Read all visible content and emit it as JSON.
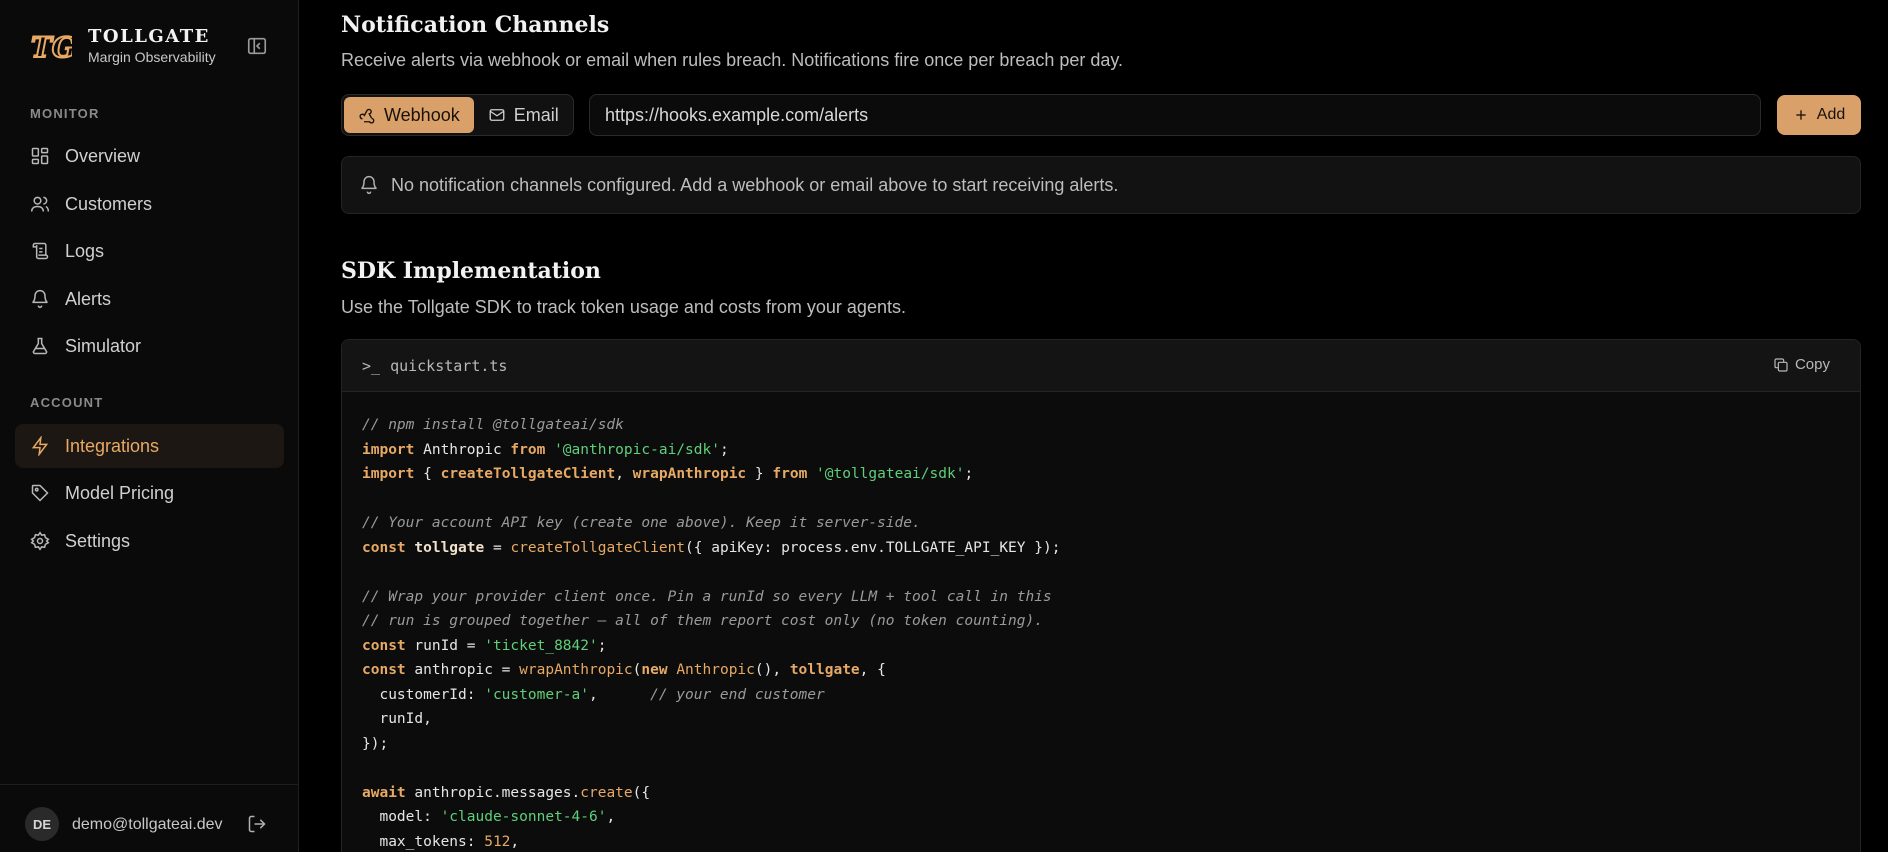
{
  "brand": {
    "name": "TOLLGATE",
    "subtitle": "Margin Observability",
    "logo_text": "TG"
  },
  "nav": {
    "monitor_label": "MONITOR",
    "account_label": "ACCOUNT",
    "items": [
      {
        "label": "Overview",
        "icon": "grid-icon"
      },
      {
        "label": "Customers",
        "icon": "users-icon"
      },
      {
        "label": "Logs",
        "icon": "scroll-icon"
      },
      {
        "label": "Alerts",
        "icon": "bell-icon"
      },
      {
        "label": "Simulator",
        "icon": "flask-icon"
      },
      {
        "label": "Integrations",
        "icon": "zap-icon",
        "active": true
      },
      {
        "label": "Model Pricing",
        "icon": "tag-icon"
      },
      {
        "label": "Settings",
        "icon": "gear-icon"
      }
    ]
  },
  "user": {
    "initials": "DE",
    "email": "demo@tollgateai.dev"
  },
  "notifications": {
    "title": "Notification Channels",
    "description": "Receive alerts via webhook or email when rules breach. Notifications fire once per breach per day.",
    "tab_webhook": "Webhook",
    "tab_email": "Email",
    "url_value": "https://hooks.example.com/alerts",
    "add_label": "Add",
    "empty_notice": "No notification channels configured. Add a webhook or email above to start receiving alerts."
  },
  "sdk": {
    "title": "SDK Implementation",
    "description": "Use the Tollgate SDK to track token usage and costs from your agents.",
    "filename": "quickstart.ts",
    "copy_label": "Copy"
  },
  "colors": {
    "accent": "#d9a06a",
    "accent_text": "#e7a964",
    "string": "#5fcf7a",
    "background": "#000000"
  }
}
